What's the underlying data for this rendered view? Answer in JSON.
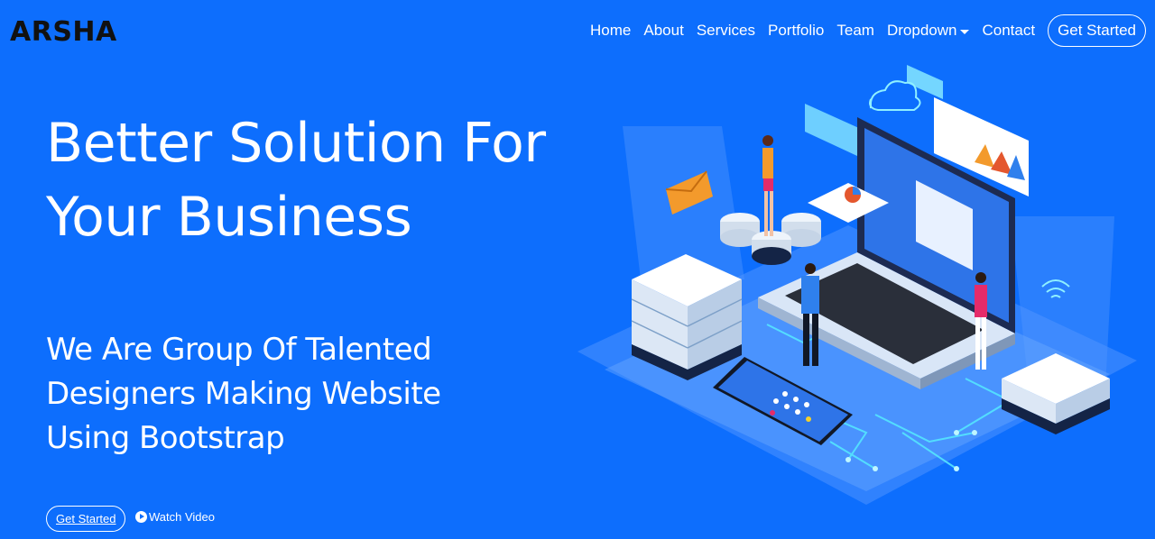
{
  "brand": {
    "logo_text": "ARSHA"
  },
  "nav": {
    "items": [
      {
        "label": "Home"
      },
      {
        "label": "About"
      },
      {
        "label": "Services"
      },
      {
        "label": "Portfolio"
      },
      {
        "label": "Team"
      },
      {
        "label": "Dropdown"
      },
      {
        "label": "Contact"
      }
    ],
    "cta_label": "Get Started"
  },
  "hero": {
    "title_line1": "Better Solution For",
    "title_line2": "Your Business",
    "subtitle_line1": "We Are Group Of Talented",
    "subtitle_line2": "Designers Making Website",
    "subtitle_line3": "Using Bootstrap",
    "get_started_label": "Get Started",
    "watch_video_label": "Watch Video"
  },
  "colors": {
    "background": "#0d6efd",
    "logo": "#111111",
    "text": "#ffffff"
  },
  "icons": {
    "play": "play-circle-icon",
    "dropdown": "caret-down-icon"
  }
}
